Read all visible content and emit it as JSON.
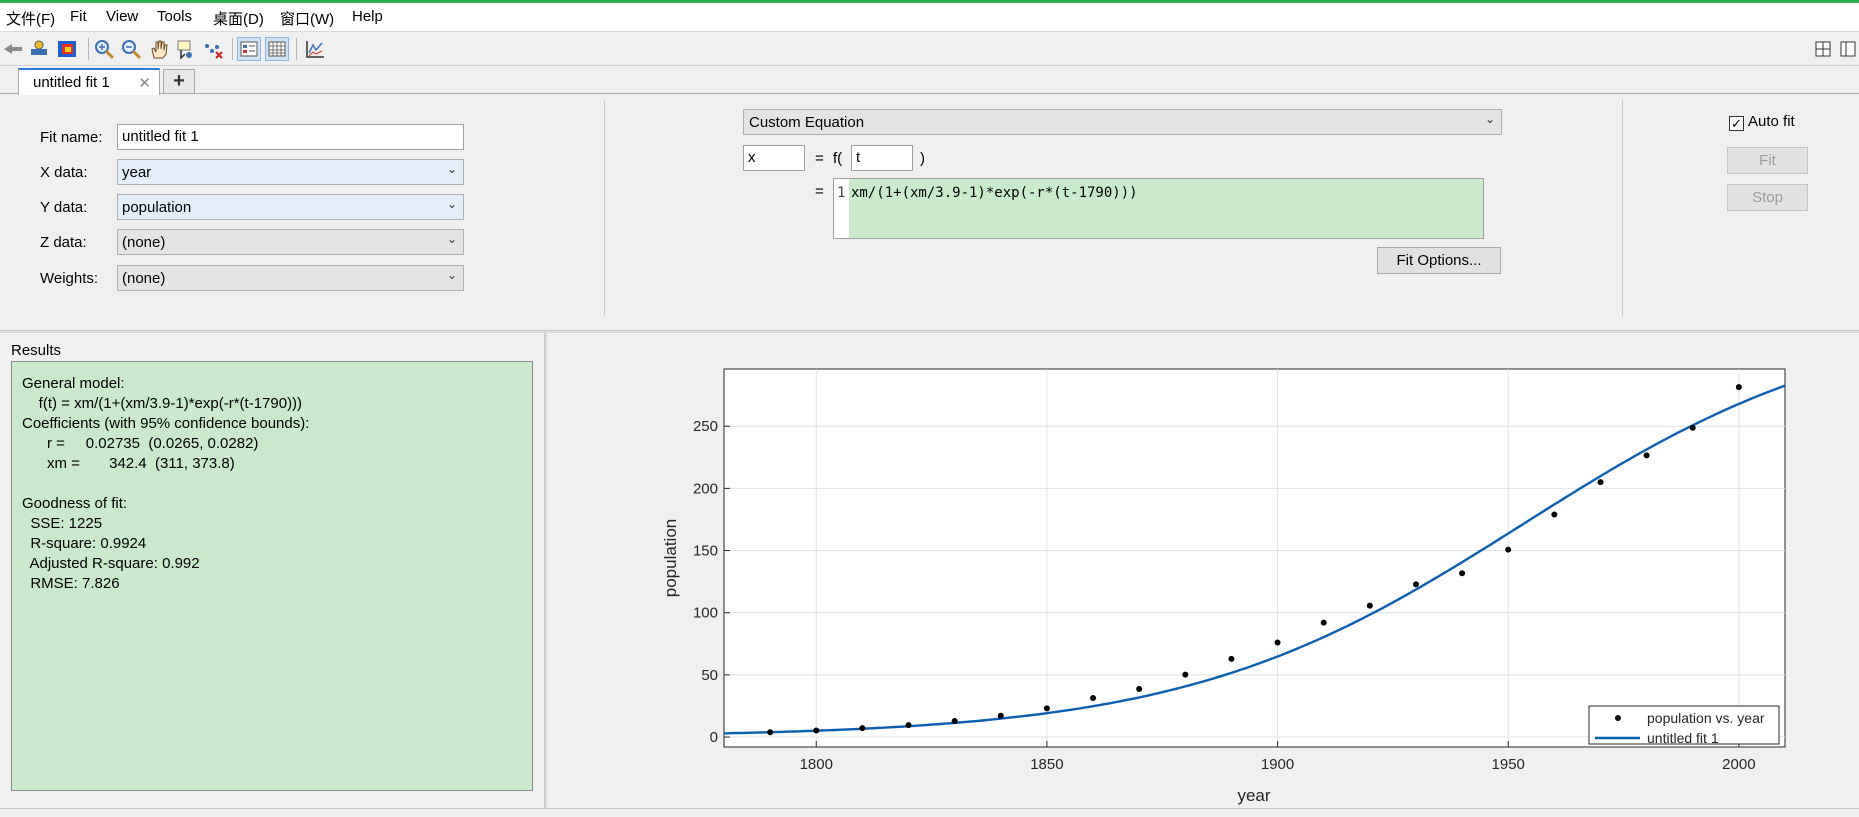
{
  "menu": [
    "文件(F)",
    "Fit",
    "View",
    "Tools",
    "桌面(D)",
    "窗口(W)",
    "Help"
  ],
  "toolbar_icons": [
    "back-arrow-icon",
    "data-cursor-icon",
    "colormap-icon",
    "zoom-in-icon",
    "zoom-out-icon",
    "pan-icon",
    "data-tip-icon",
    "exclude-outliers-icon",
    "legend-toggle-icon",
    "grid-toggle-icon",
    "residuals-plot-icon"
  ],
  "tab": {
    "label": "untitled fit 1",
    "close": "✕",
    "add": "+"
  },
  "fit": {
    "name_label": "Fit name:",
    "name_value": "untitled fit 1",
    "x_label": "X data:",
    "x_value": "year",
    "y_label": "Y data:",
    "y_value": "population",
    "z_label": "Z data:",
    "z_value": "(none)",
    "w_label": "Weights:",
    "w_value": "(none)"
  },
  "equation": {
    "type": "Custom Equation",
    "dep_var": "x",
    "eq_sign": "=",
    "f_open": "f(",
    "indep_var": "t",
    "f_close": ")",
    "eq2": "=",
    "line_no": "1",
    "expr": "xm/(1+(xm/3.9-1)*exp(-r*(t-1790)))",
    "fit_options": "Fit Options...",
    "auto_fit": "Auto fit",
    "auto_fit_checked": "✓",
    "fit_button": "Fit",
    "stop_button": "Stop"
  },
  "results": {
    "title": "Results",
    "text": "General model:\n    f(t) = xm/(1+(xm/3.9-1)*exp(-r*(t-1790)))\nCoefficients (with 95% confidence bounds):\n      r =     0.02735  (0.0265, 0.0282)\n      xm =       342.4  (311, 373.8)\n\nGoodness of fit:\n  SSE: 1225\n  R-square: 0.9924\n  Adjusted R-square: 0.992\n  RMSE: 7.826"
  },
  "chart_data": {
    "type": "scatter",
    "xlabel": "year",
    "ylabel": "population",
    "xlim": [
      1780,
      2010
    ],
    "ylim": [
      -8,
      296
    ],
    "xticks": [
      1800,
      1850,
      1900,
      1950,
      2000
    ],
    "yticks": [
      0,
      50,
      100,
      150,
      200,
      250
    ],
    "grid": true,
    "legend_position": "bottom-right",
    "series": [
      {
        "name": "population vs. year",
        "kind": "points",
        "x": [
          1790,
          1800,
          1810,
          1820,
          1830,
          1840,
          1850,
          1860,
          1870,
          1880,
          1890,
          1900,
          1910,
          1920,
          1930,
          1940,
          1950,
          1960,
          1970,
          1980,
          1990,
          2000
        ],
        "y": [
          3.9,
          5.3,
          7.2,
          9.6,
          12.9,
          17.1,
          23.1,
          31.4,
          38.6,
          50.2,
          62.9,
          76.0,
          92.0,
          105.7,
          122.8,
          131.7,
          150.7,
          179.0,
          205.0,
          226.5,
          248.7,
          281.4
        ]
      },
      {
        "name": "untitled fit 1",
        "kind": "line",
        "model": {
          "xm": 342.4,
          "r": 0.02735,
          "x0": 3.9,
          "t0": 1790
        }
      }
    ],
    "colors": {
      "points": "#000000",
      "fit": "#0b5fae"
    }
  }
}
